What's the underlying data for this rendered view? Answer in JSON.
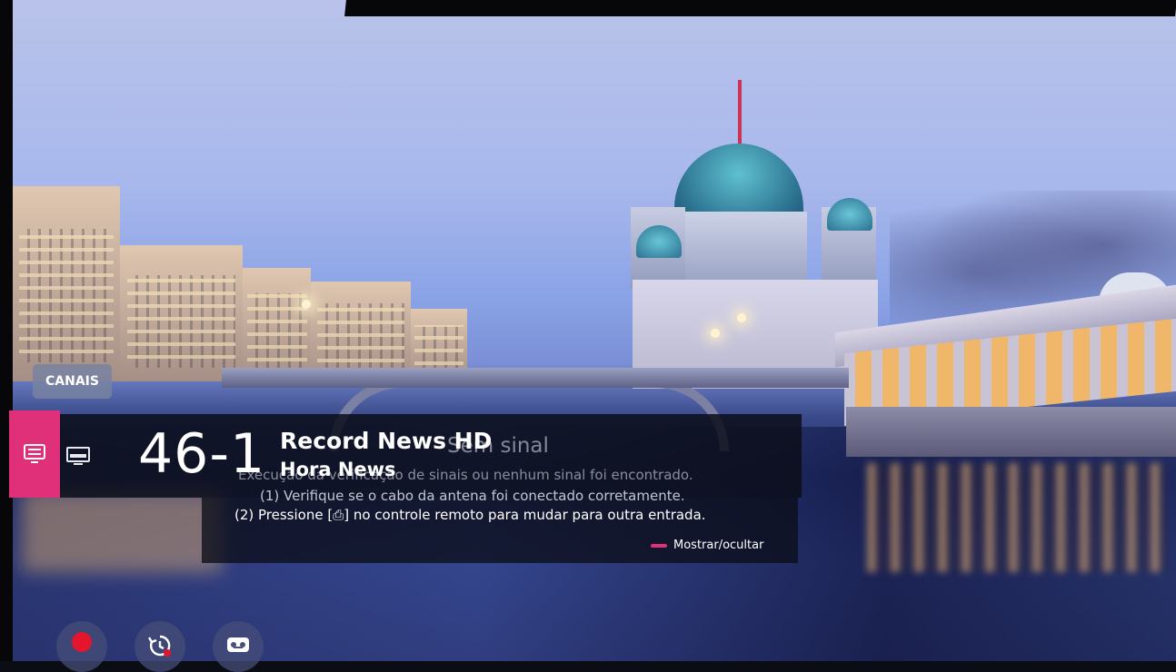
{
  "overlay": {
    "canais_label": "CANAIS",
    "channel_number": "46-1",
    "program_title": "Record News HD",
    "program_subtitle": "Hora News",
    "no_signal_title": "Sem sinal",
    "message_line1": "Execução da verificação de sinais ou nenhum sinal foi encontrado.",
    "message_line2": "(1) Verifique se o cabo da antena foi conectado corretamente.",
    "message_line3": "(2) Pressione [⎙] no controle remoto para mudar para outra entrada.",
    "toggle_hint": "Mostrar/ocultar"
  },
  "bottom_buttons": [
    {
      "icon": "record-icon"
    },
    {
      "icon": "timeshift-icon"
    },
    {
      "icon": "recordings-icon"
    }
  ],
  "colors": {
    "accent": "#e0307a",
    "record": "#e3162d",
    "panel": "#0c0e1a"
  }
}
